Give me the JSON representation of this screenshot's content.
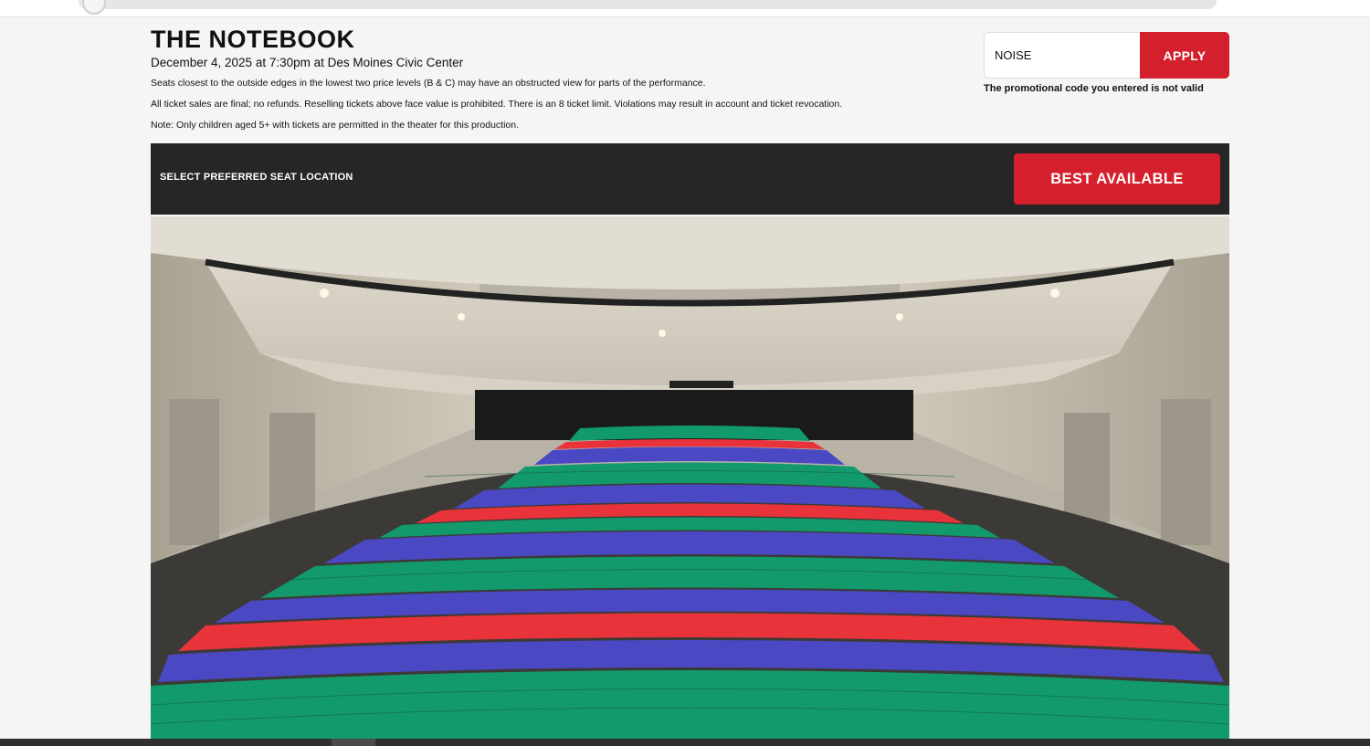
{
  "event": {
    "title": "THE NOTEBOOK",
    "date_line": "December 4, 2025 at 7:30pm at  Des Moines Civic Center",
    "notices": [
      "Seats closest to the outside edges in the lowest two price levels (B & C) may have an obstructed view for parts of the performance.",
      "All ticket sales are final; no refunds. Reselling tickets above face value is prohibited. There is an 8 ticket limit. Violations may result in account and ticket revocation.",
      "Note: Only children aged 5+ with tickets are permitted in the theater for this production."
    ]
  },
  "promo": {
    "input_value": "NOISE",
    "apply_label": "APPLY",
    "error_message": "The promotional code you entered is not valid"
  },
  "seat_selection": {
    "label": "SELECT PREFERRED SEAT LOCATION",
    "best_available_label": "BEST AVAILABLE"
  },
  "colors": {
    "accent": "#d4202c",
    "bar_background": "#262626",
    "seat_green": "#139a6c",
    "seat_blue": "#4b48c4",
    "seat_red": "#e8333a"
  }
}
